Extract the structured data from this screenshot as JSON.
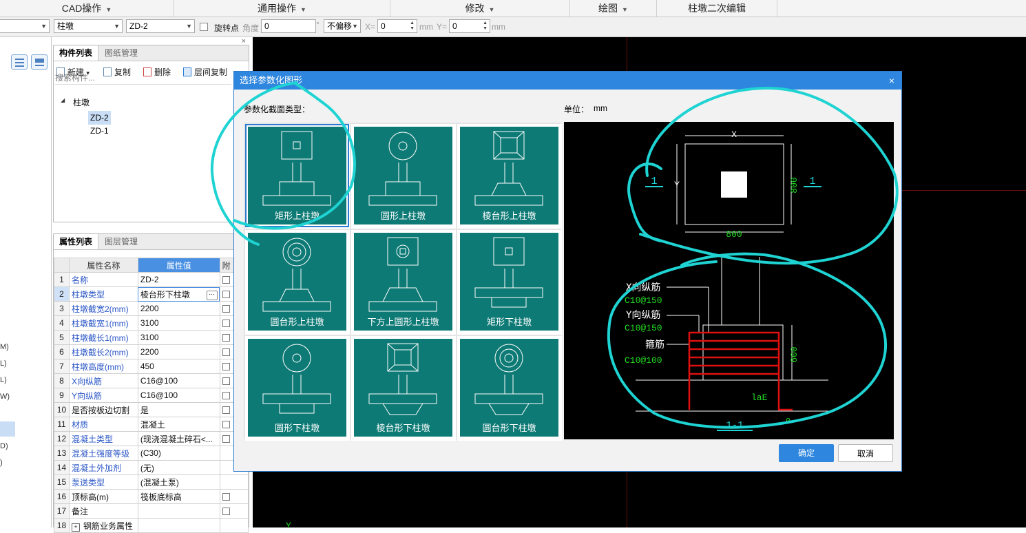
{
  "menu": {
    "items": [
      "CAD操作",
      "通用操作",
      "修改",
      "绘图",
      "柱墩二次编辑"
    ]
  },
  "toolbar": {
    "combo_type": "柱墩",
    "combo_name": "ZD-2",
    "rotate_label": "旋转点",
    "angle_label": "角度",
    "angle_value": "0",
    "degree_symbol": "°",
    "offset_mode": "不偏移",
    "x_label": "X=",
    "x_value": "0",
    "y_label": "Y=",
    "y_value": "0",
    "unit": "mm"
  },
  "left_strip": {
    "chars": [
      "M)",
      "L)",
      "L)",
      "W)",
      "))",
      "D)",
      ")"
    ]
  },
  "component_panel": {
    "tabs": [
      "构件列表",
      "图纸管理"
    ],
    "toolbar": [
      "新建",
      "复制",
      "删除",
      "层间复制"
    ],
    "new_caret": "▾",
    "search_placeholder": "搜索构件...",
    "tree_root": "柱墩",
    "tree_expand": "◢",
    "tree_items": [
      "ZD-2",
      "ZD-1"
    ],
    "close": "×"
  },
  "property_panel": {
    "tabs": [
      "属性列表",
      "图层管理"
    ],
    "headers": [
      "属性名称",
      "属性值",
      "附"
    ],
    "rows": [
      {
        "n": "1",
        "name": "名称",
        "value": "ZD-2"
      },
      {
        "n": "2",
        "name": "柱墩类型",
        "value": "棱台形下柱墩"
      },
      {
        "n": "3",
        "name": "柱墩截宽2(mm)",
        "value": "2200"
      },
      {
        "n": "4",
        "name": "柱墩截宽1(mm)",
        "value": "3100"
      },
      {
        "n": "5",
        "name": "柱墩截长1(mm)",
        "value": "3100"
      },
      {
        "n": "6",
        "name": "柱墩截长2(mm)",
        "value": "2200"
      },
      {
        "n": "7",
        "name": "柱墩高度(mm)",
        "value": "450"
      },
      {
        "n": "8",
        "name": "X向纵筋",
        "value": "C16@100"
      },
      {
        "n": "9",
        "name": "Y向纵筋",
        "value": "C16@100"
      },
      {
        "n": "10",
        "name": "是否按板边切割",
        "value": "是"
      },
      {
        "n": "11",
        "name": "材质",
        "value": "混凝土"
      },
      {
        "n": "12",
        "name": "混凝土类型",
        "value": "(现浇混凝土碎石<..."
      },
      {
        "n": "13",
        "name": "混凝土强度等级",
        "value": "(C30)"
      },
      {
        "n": "14",
        "name": "混凝土外加剂",
        "value": "(无)"
      },
      {
        "n": "15",
        "name": "泵送类型",
        "value": "(混凝土泵)"
      },
      {
        "n": "16",
        "name": "顶标高(m)",
        "value": "筏板底标高"
      },
      {
        "n": "17",
        "name": "备注",
        "value": ""
      },
      {
        "n": "18",
        "name": "钢筋业务属性",
        "value": ""
      }
    ],
    "expand_symbol": "+",
    "edit_button": "···"
  },
  "canvas": {
    "axis_label": "Y"
  },
  "dialog": {
    "title": "选择参数化图形",
    "close": "×",
    "section_label": "参数化截面类型：",
    "unit_label": "单位：",
    "unit_value": "mm",
    "shapes": [
      "矩形上柱墩",
      "圆形上柱墩",
      "棱台形上柱墩",
      "圆台形上柱墩",
      "下方上圆形上柱墩",
      "矩形下柱墩",
      "圆形下柱墩",
      "棱台形下柱墩",
      "圆台形下柱墩"
    ],
    "ok_label": "确定",
    "cancel_label": "取消",
    "preview": {
      "dim_x": "X",
      "dim_y": "Y",
      "dim_w": "800",
      "dim_h": "800",
      "section_mark": "1",
      "label_x_bar": "X向纵筋",
      "label_x_bar_spec": "C10@150",
      "label_y_bar": "Y向纵筋",
      "label_y_bar_spec": "C10@150",
      "label_stirrup": "箍筋",
      "label_stirrup_spec": "C10@100",
      "dim_600": "600",
      "dim_lae": "laE",
      "section_title": "1-1",
      "dim_bottom": "0"
    }
  },
  "colors": {
    "teal_tile": "#0e7a75",
    "accent_blue": "#2e86de",
    "annotation_cyan": "#1fd3d3",
    "rebar_red": "#e01010",
    "dim_green": "#22dd22"
  }
}
